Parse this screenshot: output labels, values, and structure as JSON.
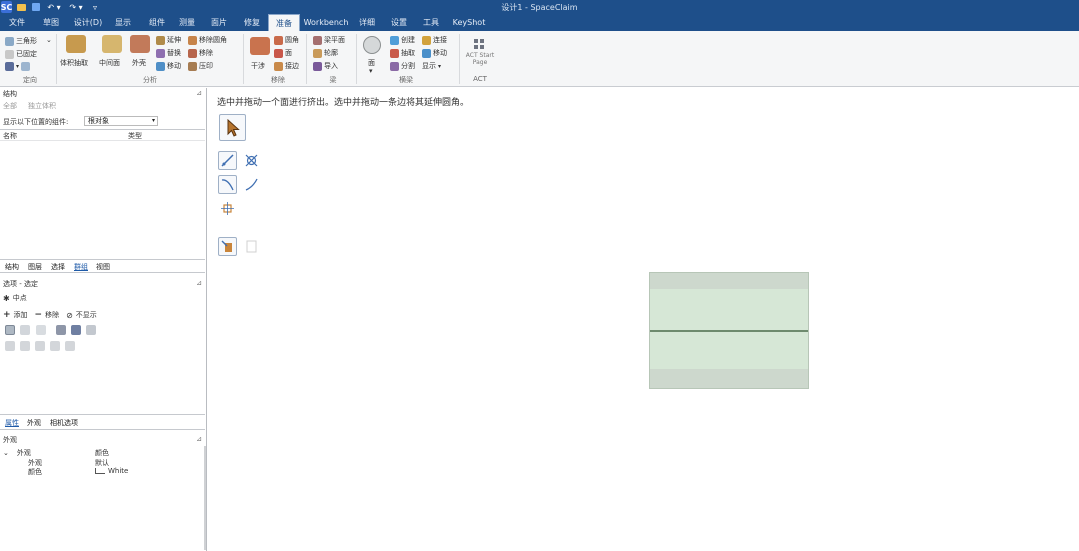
{
  "titlebar": {
    "app_logo": "SC",
    "title": "设计1 - SpaceClaim"
  },
  "menu": {
    "tabs": [
      "文件",
      "草图",
      "设计(D)",
      "显示",
      "组件",
      "测量",
      "面片",
      "修复",
      "准备",
      "Workbench",
      "详细",
      "设置",
      "工具",
      "KeyShot"
    ],
    "active_index": 8
  },
  "ribbon": {
    "group1": {
      "items": [
        "三角形",
        "已固定",
        "⌄"
      ],
      "label": "定向"
    },
    "group2": {
      "big": [
        "体积抽取",
        "中间面",
        "外壳"
      ],
      "small": [
        "延伸",
        "替换",
        "移动",
        "移除圆角",
        "移除",
        "压印"
      ],
      "label": "分析"
    },
    "group3": {
      "big": [
        "干涉"
      ],
      "small": [
        "圆角",
        "面",
        "接边"
      ],
      "label": "移除"
    },
    "group4": {
      "small": [
        "梁平面",
        "轮廓",
        "导入"
      ],
      "label": "梁"
    },
    "group5": {
      "big": [
        "面"
      ],
      "small": [
        "创建",
        "抽取",
        "分割",
        "连接",
        "移动",
        "显示"
      ],
      "label": "横梁"
    },
    "group6": {
      "big": [
        "ACT Start Page"
      ],
      "label": "ACT"
    }
  },
  "left_panel": {
    "structure_header": "结构",
    "toolbar_row": [
      "全部",
      "独立体积"
    ],
    "filter_label": "显示以下位置的组件:",
    "filter_value": "根对象",
    "col_name": "名称",
    "col_type": "类型",
    "tabs": [
      "结构",
      "图层",
      "选择",
      "群组",
      "视图"
    ],
    "tabs_active_index": 3,
    "options_header": "选项 - 选定",
    "options_item": "中点",
    "ops_row": [
      "添加",
      "移除",
      "不显示"
    ],
    "prop_tabs": [
      "属性",
      "外观",
      "相机选项"
    ],
    "prop_tabs_active_index": 0,
    "prop_header": "外观",
    "prop_group": "外观",
    "prop_col_name": "颜色",
    "prop_rows": [
      {
        "name": "外观",
        "value": "默认"
      },
      {
        "name": "颜色",
        "value": "White"
      }
    ]
  },
  "canvas": {
    "hint": "选中并拖动一个面进行挤出。选中并拖动一条边将其延伸圆角。"
  },
  "colors": {
    "title_bg": "#1e4f8a",
    "sketch_fill": "#d6e7d6",
    "sketch_line": "#6e8a6e"
  }
}
